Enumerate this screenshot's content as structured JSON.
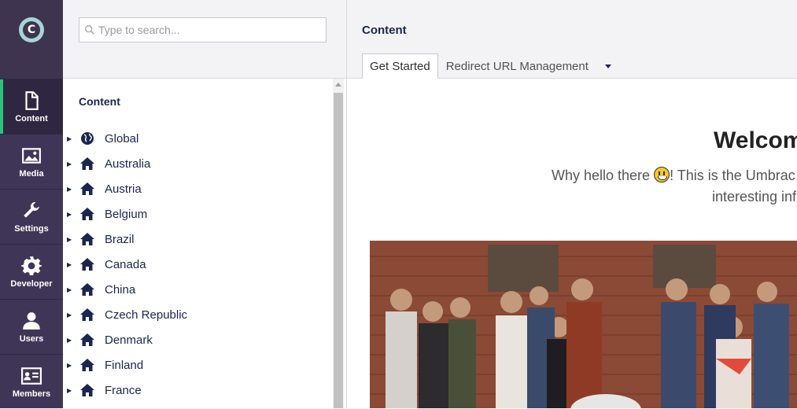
{
  "rail": {
    "logo_letter": "C",
    "items": [
      {
        "label": "Content",
        "icon": "document-icon"
      },
      {
        "label": "Media",
        "icon": "image-icon"
      },
      {
        "label": "Settings",
        "icon": "wrench-icon"
      },
      {
        "label": "Developer",
        "icon": "gear-icon"
      },
      {
        "label": "Users",
        "icon": "user-icon"
      },
      {
        "label": "Members",
        "icon": "id-card-icon"
      }
    ]
  },
  "tree": {
    "search_placeholder": "Type to search...",
    "title": "Content",
    "items": [
      {
        "label": "Global",
        "icon": "globe-icon"
      },
      {
        "label": "Australia",
        "icon": "home-icon"
      },
      {
        "label": "Austria",
        "icon": "home-icon"
      },
      {
        "label": "Belgium",
        "icon": "home-icon"
      },
      {
        "label": "Brazil",
        "icon": "home-icon"
      },
      {
        "label": "Canada",
        "icon": "home-icon"
      },
      {
        "label": "China",
        "icon": "home-icon"
      },
      {
        "label": "Czech Republic",
        "icon": "home-icon"
      },
      {
        "label": "Denmark",
        "icon": "home-icon"
      },
      {
        "label": "Finland",
        "icon": "home-icon"
      },
      {
        "label": "France",
        "icon": "home-icon"
      }
    ]
  },
  "main": {
    "title": "Content",
    "tabs": [
      {
        "label": "Get Started"
      },
      {
        "label": "Redirect URL Management"
      }
    ],
    "welcome": "Welcom",
    "intro_before_emoji": "Why hello there ",
    "intro_after_emoji": "! This is the Umbrac",
    "intro_line2": "interesting inf"
  },
  "colors": {
    "rail_bg": "#3f3657",
    "active_indicator": "#2bc37c",
    "text_primary": "#1b264f"
  }
}
